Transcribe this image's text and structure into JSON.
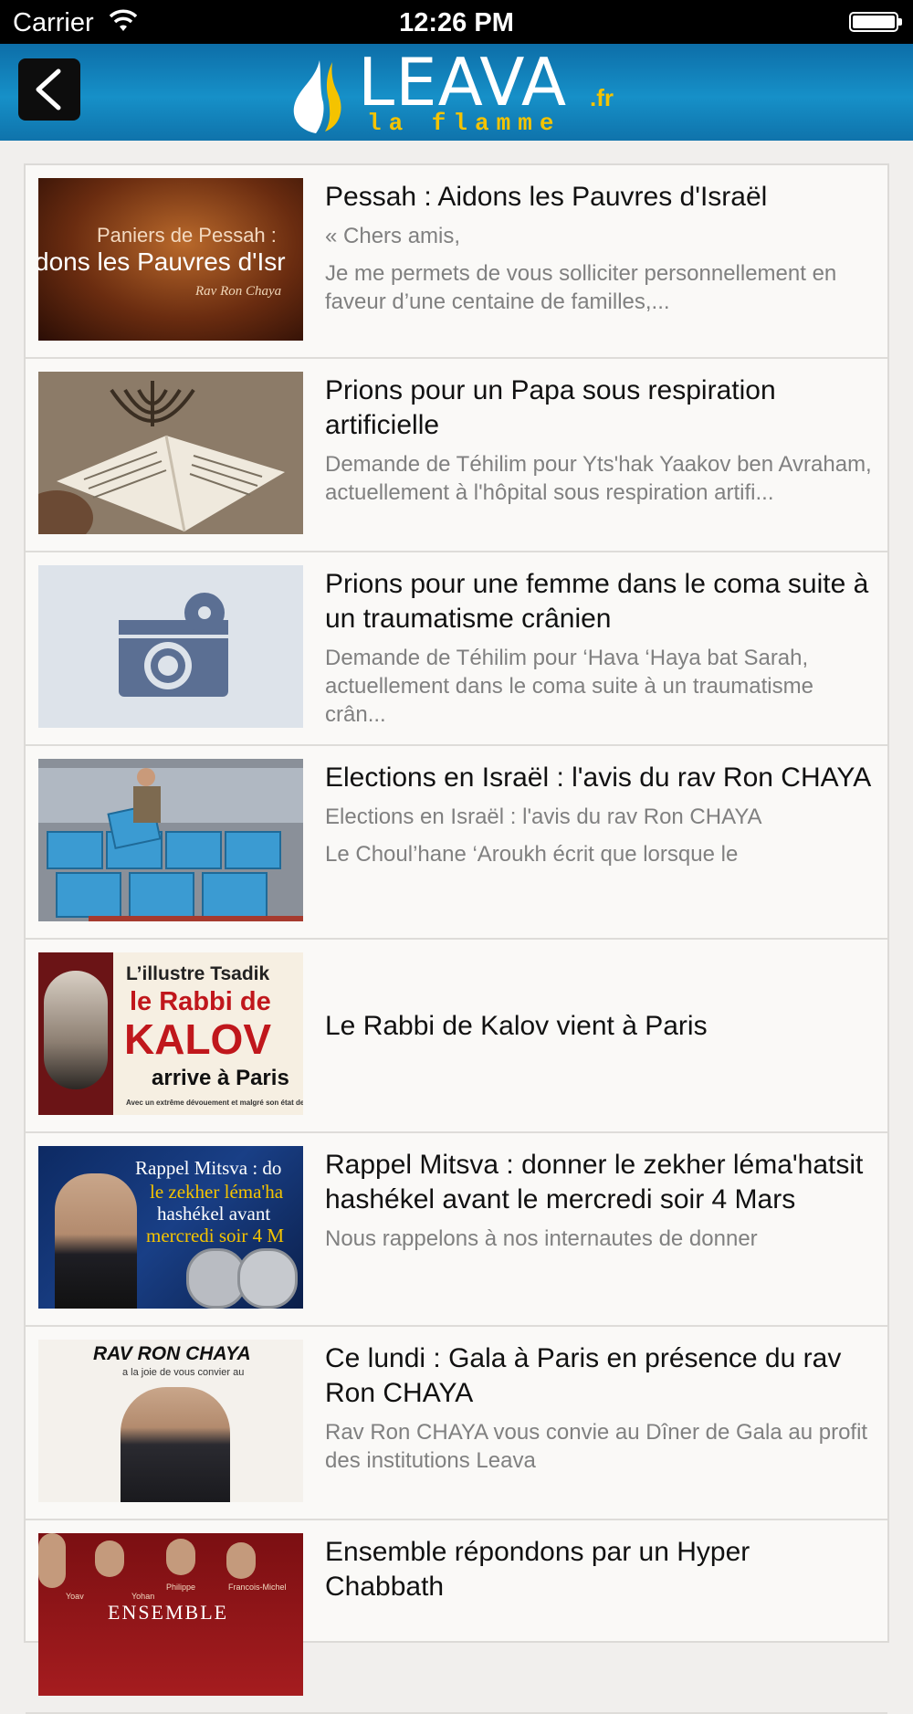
{
  "status_bar": {
    "carrier": "Carrier",
    "time": "12:26 PM"
  },
  "header": {
    "logo_brand": "LEAVA",
    "logo_suffix": ".fr",
    "logo_tagline": "la flamme"
  },
  "articles": [
    {
      "title": "Pessah : Aidons les Pauvres d'Israël",
      "excerpt": "« Chers amis,",
      "excerpt2": "Je me permets de vous solliciter personnellement en faveur d’une centaine de familles,...",
      "thumb_caption_1": "Paniers de Pessah :",
      "thumb_caption_2": "dons les Pauvres d'Isr",
      "thumb_caption_3": "Rav Ron Chaya"
    },
    {
      "title": "Prions pour un Papa sous respiration artificielle",
      "excerpt": "Demande de Téhilim pour Yts'hak Yaakov ben Avraham, actuellement à l'hôpital sous respiration artifi..."
    },
    {
      "title": "Prions pour une femme dans le coma suite à un traumatisme crânien",
      "excerpt": "Demande de Téhilim pour ‘Hava ‘Haya bat Sarah, actuellement dans le coma suite à un traumatisme crân..."
    },
    {
      "title": "Elections en Israël : l'avis du rav Ron CHAYA",
      "excerpt": "Elections en Israël : l'avis du rav Ron CHAYA",
      "excerpt2": "Le Choul’hane ‘Aroukh écrit que lorsque le"
    },
    {
      "title": "Le Rabbi de Kalov vient à Paris",
      "thumb_caption_1": "L’illustre Tsadik",
      "thumb_caption_2": "le Rabbi de",
      "thumb_caption_3": "KALOV",
      "thumb_caption_4": "arrive à Paris",
      "thumb_caption_5": "Avec un extrême dévouement et malgré son état de"
    },
    {
      "title": "Rappel Mitsva : donner le zekher léma'hatsit hashékel avant le mercredi soir 4 Mars",
      "excerpt": "Nous rappelons à nos internautes de donner",
      "thumb_caption_1": "Rappel Mitsva : do",
      "thumb_caption_2": "le zekher léma'ha",
      "thumb_caption_3": "hashékel avant",
      "thumb_caption_4": "mercredi soir 4 M"
    },
    {
      "title": "Ce lundi : Gala à Paris en présence du rav Ron CHAYA",
      "excerpt": "Rav Ron CHAYA vous convie au Dîner de Gala au profit des institutions Leava",
      "thumb_caption_1": "RAV RON CHAYA",
      "thumb_caption_2": "a la joie de vous convier au"
    },
    {
      "title": "Ensemble répondons par un Hyper Chabbath",
      "thumb_caption_1": "ENSEMBLE",
      "thumb_caption_2": "Yoav",
      "thumb_caption_3": "Yohan",
      "thumb_caption_4": "Philippe",
      "thumb_caption_5": "Francois-Michel"
    }
  ],
  "colors": {
    "header_blue": "#1690c8",
    "logo_yellow": "#f4c300",
    "excerpt_gray": "#808080",
    "background": "#f1efed"
  }
}
